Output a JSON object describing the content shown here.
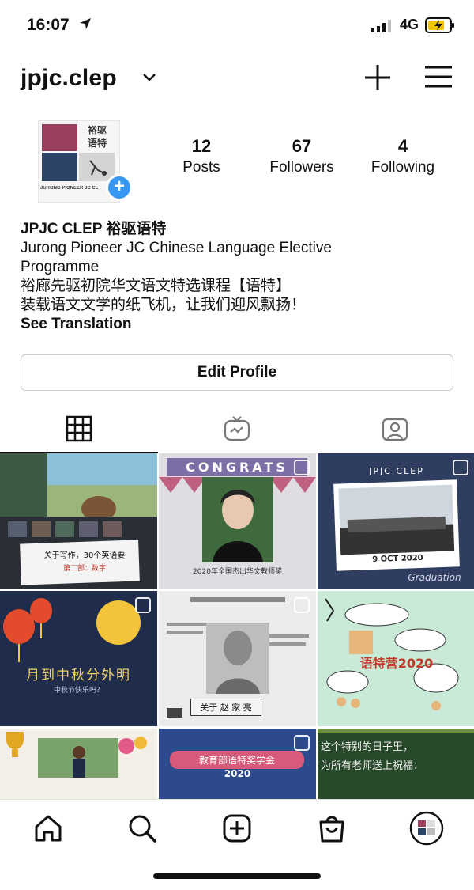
{
  "status_bar": {
    "time": "16:07",
    "network": "4G"
  },
  "header": {
    "username": "jpjc.clep"
  },
  "profile": {
    "avatar_logo_text": "裕驱\n语特",
    "avatar_caption": "JURONG PIONEER JC CL",
    "stats": {
      "posts_count": "12",
      "posts_label": "Posts",
      "followers_count": "67",
      "followers_label": "Followers",
      "following_count": "4",
      "following_label": "Following"
    },
    "bio": {
      "name": "JPJC CLEP 裕驱语特",
      "line1": "Jurong Pioneer JC Chinese Language Elective",
      "line2": "Programme",
      "line3": "裕廊先驱初院华文语文特选课程【语特】",
      "line4": "装载语文文学的纸飞机，让我们迎风飘扬！",
      "see_translation": "See Translation"
    },
    "edit_profile_label": "Edit Profile"
  },
  "grid": {
    "post1_text": "关于写作，30个英语要",
    "post1_sub": "第二部：数字",
    "post2_banner": "CONGRATS",
    "post2_caption": "2020年全国杰出华文教师奖",
    "post3_title": "JPJC CLEP",
    "post3_date": "9 OCT 2020",
    "post3_script": "Graduation",
    "post4_title": "月到中秋分外明",
    "post4_sub": "中秋节快乐吗？",
    "post5_caption": "关于 赵 家 亮",
    "post6_title": "语特营2020",
    "post8_title": "教育部语特奖学金",
    "post8_year": "2020",
    "post9_line1": "这个特别的日子里，",
    "post9_line2": "为所有老师送上祝福："
  },
  "colors": {
    "accent_blue": "#3897f0",
    "text": "#111111",
    "border": "#cfcfcf"
  }
}
